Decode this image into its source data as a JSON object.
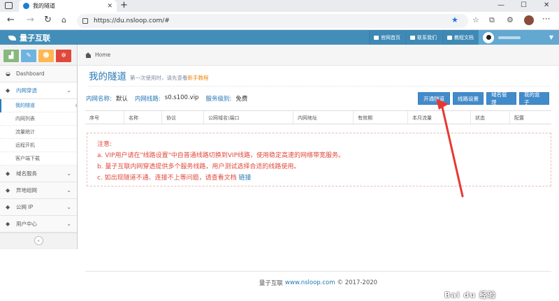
{
  "browser": {
    "tab_title": "我的隧道",
    "url": "https://du.nsloop.com/#"
  },
  "header": {
    "brand": "量子互联",
    "links": [
      "官网首页",
      "联系我们",
      "教程文档"
    ]
  },
  "sidebar": {
    "shortcut_colors": [
      "#87b87f",
      "#6fb3e0",
      "#ffb752",
      "#e0483b"
    ],
    "items": [
      {
        "label": "Dashboard",
        "icon": "dashboard-icon"
      },
      {
        "label": "内网穿透",
        "icon": "tag-icon",
        "open": true
      },
      {
        "label": "域名服务",
        "icon": "tag-icon"
      },
      {
        "label": "异地组网",
        "icon": "tag-icon"
      },
      {
        "label": "公网 IP",
        "icon": "tag-icon"
      },
      {
        "label": "用户中心",
        "icon": "tag-icon"
      }
    ],
    "sub_items": [
      "我的隧道",
      "内网列表",
      "流量统计",
      "远程开机",
      "客户端下载"
    ]
  },
  "breadcrumb": {
    "home": "Home"
  },
  "page": {
    "title": "我的隧道",
    "subtitle": "第一次使用时，请先查看",
    "subtitle_link": "新手教程"
  },
  "info": {
    "name_label": "内网名称:",
    "name_value": "默认",
    "line_label": "内网线路:",
    "line_value": "s0.s100.vip",
    "level_label": "服务级别:",
    "level_value": "免费"
  },
  "buttons": [
    "开通隧道",
    "线路设置",
    "域名管理",
    "我的盒子"
  ],
  "table": {
    "headers": [
      "序号",
      "名称",
      "协议",
      "公网域名\\端口",
      "内网地址",
      "有效期",
      "本月流量",
      "状态",
      "配置"
    ]
  },
  "notice": {
    "title": "注意:",
    "line_a": "a. VIP用户请在\"线路设置\"中自普通线路切换到VIP线路，使用稳定高速的网络带宽服务。",
    "line_b": "b. 量子互联内网穿透提供多个服务线路，用户测试选择合适的线路使用。",
    "line_c": "c. 如出现隧道不通、连接不上等问题，请查看文档",
    "line_c_link": "链接"
  },
  "footer": {
    "brand": "量子互联",
    "site": "www.nsloop.com",
    "copyright": "© 2017-2020"
  },
  "colors": {
    "header_bg": "#438eb9",
    "accent": "#2679b5",
    "button": "#428bca",
    "notice_text": "#e0483b",
    "arrow": "#e53935"
  }
}
